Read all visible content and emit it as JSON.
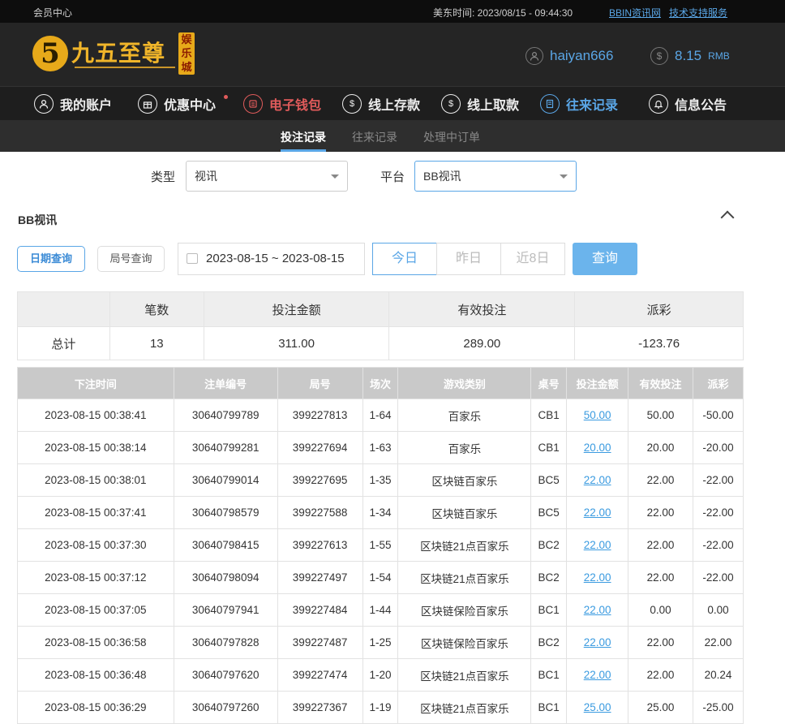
{
  "topbar": {
    "member_center": "会员中心",
    "time_label": "美东时间: 2023/08/15 - 09:44:30",
    "link_news": "BBIN资讯网",
    "link_support": "技术支持服务"
  },
  "header": {
    "logo_text": "九五至尊",
    "logo_badge": "娱乐城",
    "logo_digit": "5",
    "username": "haiyan666",
    "balance": "8.15",
    "balance_unit": "RMB",
    "user_icon": "user-icon",
    "coin_icon": "dollar-icon"
  },
  "nav": {
    "items": [
      {
        "label": "我的账户",
        "icon": "user-icon"
      },
      {
        "label": "优惠中心",
        "icon": "gift-icon"
      },
      {
        "label": "电子钱包",
        "icon": "wallet-icon"
      },
      {
        "label": "线上存款",
        "icon": "deposit-icon"
      },
      {
        "label": "线上取款",
        "icon": "withdraw-icon"
      },
      {
        "label": "往来记录",
        "icon": "record-icon"
      },
      {
        "label": "信息公告",
        "icon": "bell-icon"
      }
    ]
  },
  "subnav": {
    "tabs": [
      "投注记录",
      "往来记录",
      "处理中订单"
    ]
  },
  "filter": {
    "type_label": "类型",
    "type_value": "视讯",
    "platform_label": "平台",
    "platform_value": "BB视讯"
  },
  "section": {
    "title": "BB视讯"
  },
  "query": {
    "mode_date": "日期查询",
    "mode_round": "局号查询",
    "date_range": "2023-08-15 ~ 2023-08-15",
    "today": "今日",
    "yesterday": "昨日",
    "last8": "近8日",
    "search": "查询"
  },
  "summary": {
    "headers": [
      "",
      "笔数",
      "投注金额",
      "有效投注",
      "派彩"
    ],
    "row": [
      "总计",
      "13",
      "311.00",
      "289.00",
      "-123.76"
    ]
  },
  "records": {
    "headers": [
      "下注时间",
      "注单编号",
      "局号",
      "场次",
      "游戏类别",
      "桌号",
      "投注金额",
      "有效投注",
      "派彩"
    ],
    "rows": [
      [
        "2023-08-15 00:38:41",
        "30640799789",
        "399227813",
        "1-64",
        "百家乐",
        "CB1",
        "50.00",
        "50.00",
        "-50.00"
      ],
      [
        "2023-08-15 00:38:14",
        "30640799281",
        "399227694",
        "1-63",
        "百家乐",
        "CB1",
        "20.00",
        "20.00",
        "-20.00"
      ],
      [
        "2023-08-15 00:38:01",
        "30640799014",
        "399227695",
        "1-35",
        "区块链百家乐",
        "BC5",
        "22.00",
        "22.00",
        "-22.00"
      ],
      [
        "2023-08-15 00:37:41",
        "30640798579",
        "399227588",
        "1-34",
        "区块链百家乐",
        "BC5",
        "22.00",
        "22.00",
        "-22.00"
      ],
      [
        "2023-08-15 00:37:30",
        "30640798415",
        "399227613",
        "1-55",
        "区块链21点百家乐",
        "BC2",
        "22.00",
        "22.00",
        "-22.00"
      ],
      [
        "2023-08-15 00:37:12",
        "30640798094",
        "399227497",
        "1-54",
        "区块链21点百家乐",
        "BC2",
        "22.00",
        "22.00",
        "-22.00"
      ],
      [
        "2023-08-15 00:37:05",
        "30640797941",
        "399227484",
        "1-44",
        "区块链保险百家乐",
        "BC1",
        "22.00",
        "0.00",
        "0.00"
      ],
      [
        "2023-08-15 00:36:58",
        "30640797828",
        "399227487",
        "1-25",
        "区块链保险百家乐",
        "BC2",
        "22.00",
        "22.00",
        "22.00"
      ],
      [
        "2023-08-15 00:36:48",
        "30640797620",
        "399227474",
        "1-20",
        "区块链21点百家乐",
        "BC1",
        "22.00",
        "22.00",
        "20.24"
      ],
      [
        "2023-08-15 00:36:29",
        "30640797260",
        "399227367",
        "1-19",
        "区块链21点百家乐",
        "BC1",
        "25.00",
        "25.00",
        "-25.00"
      ]
    ]
  },
  "colors": {
    "accent": "#5aa6e6",
    "negative": "#e0444a",
    "gold": "#e7a91a"
  }
}
